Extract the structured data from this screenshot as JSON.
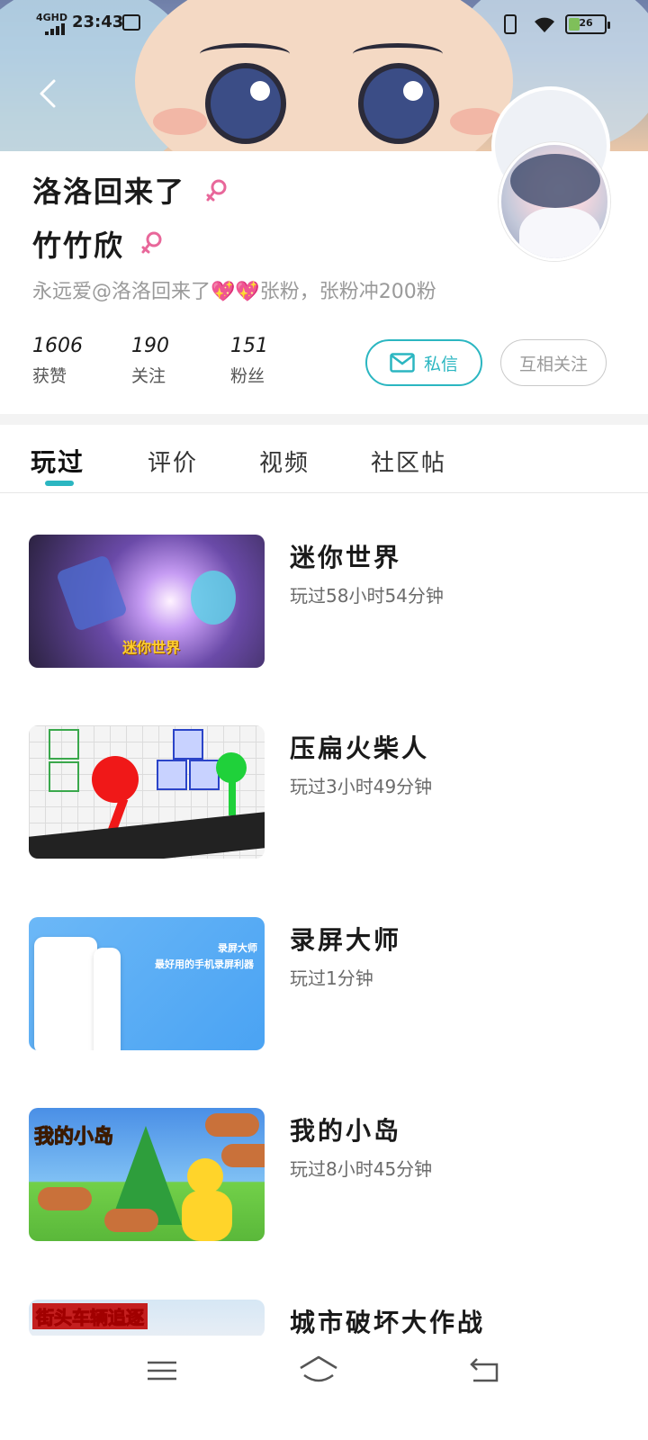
{
  "status_bar": {
    "network": "4GHD",
    "time": "23:43",
    "battery": "26"
  },
  "profile": {
    "nickname": "洛洛回来了",
    "second_name": "竹竹欣",
    "bio": "永远爱@洛洛回来了💖💖张粉，张粉冲200粉",
    "stats": [
      {
        "value": "1606",
        "label": "获赞"
      },
      {
        "value": "190",
        "label": "关注"
      },
      {
        "value": "151",
        "label": "粉丝"
      }
    ],
    "message_button": "私信",
    "follow_button": "互相关注"
  },
  "tabs": [
    {
      "label": "玩过",
      "active": true
    },
    {
      "label": "评价",
      "active": false
    },
    {
      "label": "视频",
      "active": false
    },
    {
      "label": "社区帖",
      "active": false
    }
  ],
  "games": [
    {
      "name": "迷你世界",
      "playtime": "玩过58小时54分钟",
      "thumb_text": "迷你世界"
    },
    {
      "name": "压扁火柴人",
      "playtime": "玩过3小时49分钟",
      "thumb_text": ""
    },
    {
      "name": "录屏大师",
      "playtime": "玩过1分钟",
      "thumb_text": "最好用的手机录屏利器",
      "thumb_brand": "录屏大师"
    },
    {
      "name": "我的小岛",
      "playtime": "玩过8小时45分钟",
      "thumb_text": "我的小岛"
    },
    {
      "name": "城市破坏大作战",
      "playtime": "",
      "thumb_text": "街头车辆追逐"
    }
  ],
  "colors": {
    "accent": "#2bb6c1",
    "gender_female": "#e8679a",
    "muted_text": "#9a9a9a"
  },
  "icons": {
    "back": "chevron-left-icon",
    "gender": "female-gender-icon",
    "message": "envelope-icon",
    "nav_menu": "menu-icon",
    "nav_home": "home-icon",
    "nav_back": "back-arrow-icon"
  }
}
